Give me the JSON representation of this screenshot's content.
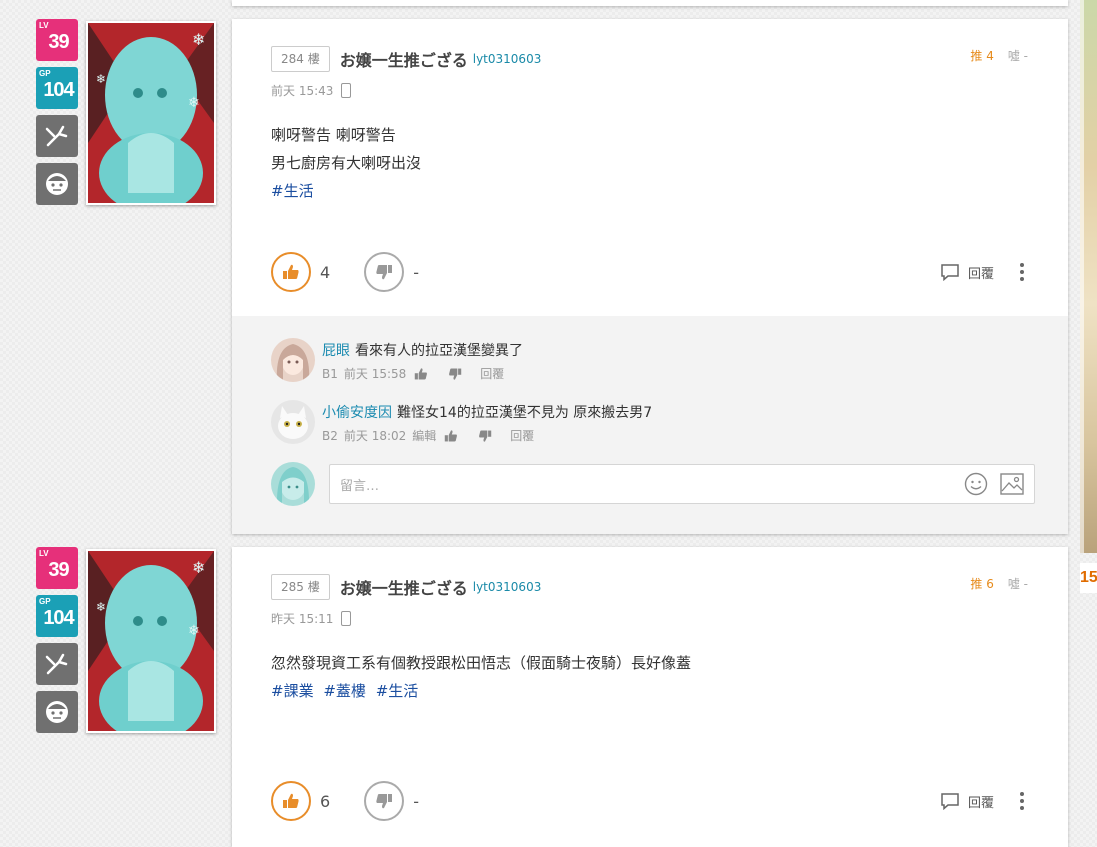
{
  "posts": [
    {
      "floor": "284 樓",
      "author": "お嬢一生推ござる",
      "author_id": "lyt0310603",
      "time": "前天 15:43",
      "gp_label": "推 4",
      "bp_label": "噓 -",
      "lines": [
        "喇呀警告 喇呀警告",
        "男七廚房有大喇呀出沒"
      ],
      "tags": [
        "#生活"
      ],
      "gp_count": "4",
      "bp_count": "-",
      "reply_label": "回覆",
      "badges": {
        "lv_tag": "LV",
        "lv": "39",
        "gp_tag": "GP",
        "gp": "104"
      },
      "comments": [
        {
          "user": "屁眼",
          "text": "看來有人的拉亞漢堡變異了",
          "floor": "B1",
          "time": "前天 15:58",
          "edit": "",
          "reply": "回覆"
        },
        {
          "user": "小偷安度因",
          "text": "難怪女14的拉亞漢堡不見为 原來搬去男7",
          "floor": "B2",
          "time": "前天 18:02",
          "edit": "編輯",
          "reply": "回覆"
        }
      ],
      "input_placeholder": "留言…"
    },
    {
      "floor": "285 樓",
      "author": "お嬢一生推ござる",
      "author_id": "lyt0310603",
      "time": "昨天 15:11",
      "gp_label": "推 6",
      "bp_label": "噓 -",
      "lines": [
        "忽然發現資工系有個教授跟松田悟志（假面騎士夜騎）長好像蓋"
      ],
      "tags": [
        "#課業",
        "#蓋樓",
        "#生活"
      ],
      "gp_count": "6",
      "bp_count": "-",
      "reply_label": "回覆",
      "badges": {
        "lv_tag": "LV",
        "lv": "39",
        "gp_tag": "GP",
        "gp": "104"
      }
    }
  ],
  "side_badge_text": "15",
  "colors": {
    "gp": "#e88d2a",
    "lv_badge": "#e6307a",
    "gp_badge": "#1ba0b6",
    "link": "#1b8bb0",
    "tag": "#1b4ea0"
  },
  "icons": [
    "thumb-up-icon",
    "thumb-down-icon",
    "comment-icon",
    "more-vertical-icon",
    "phone-icon",
    "emoji-icon",
    "image-icon",
    "wrench-icon",
    "face-icon"
  ]
}
